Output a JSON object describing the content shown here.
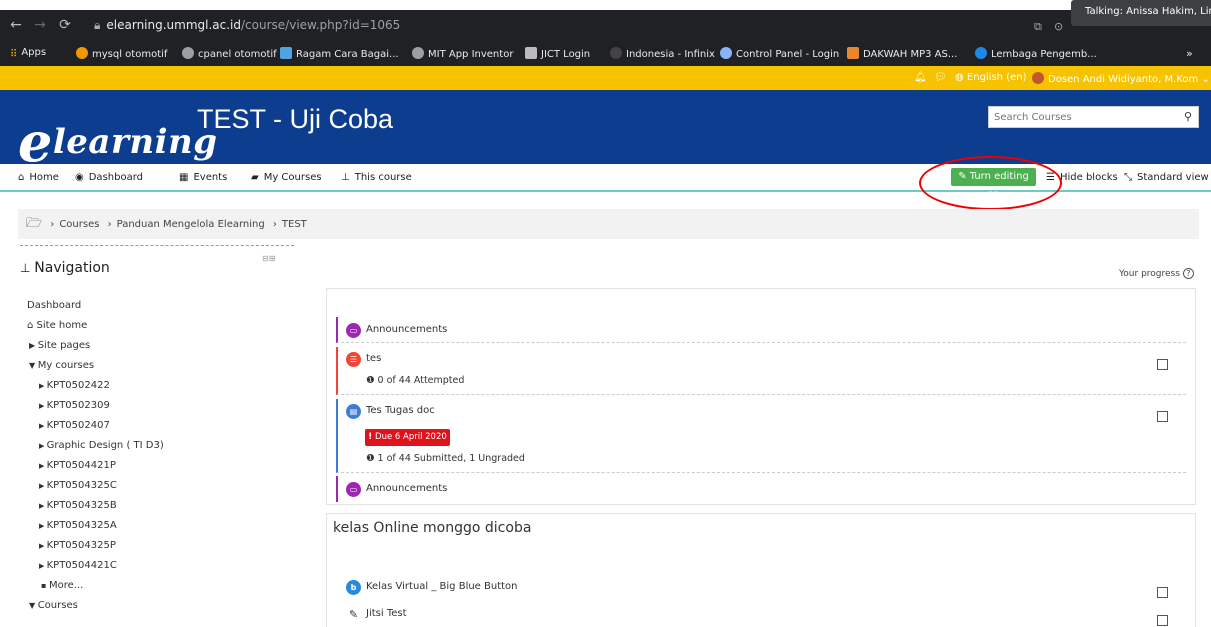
{
  "browser": {
    "url_domain": "elearning.ummgl.ac.id",
    "url_path": "/course/view.php?id=1065",
    "talking": "Talking: Anissa Hakim, Lin",
    "bookmarks": [
      {
        "label": "Apps",
        "color": "#f4b400"
      },
      {
        "label": "mysql otomotif",
        "color": "#f29900"
      },
      {
        "label": "cpanel otomotif",
        "color": "#9aa0a6"
      },
      {
        "label": "Ragam Cara Bagai...",
        "color": "#4fa3e3"
      },
      {
        "label": "MIT App Inventor",
        "color": "#9aa0a6"
      },
      {
        "label": "JICT Login",
        "color": "#bbbbbb"
      },
      {
        "label": "Indonesia - Infinix",
        "color": "#444444"
      },
      {
        "label": "Control Panel - Login",
        "color": "#8ab4f8"
      },
      {
        "label": "DAKWAH MP3 AS...",
        "color": "#e8872e"
      },
      {
        "label": "Lembaga Pengemb...",
        "color": "#1e88e5"
      }
    ],
    "bookmarks_more": "»"
  },
  "topbar": {
    "language": "English (en)",
    "user": "Dosen Andi Widiyanto, M.Kom"
  },
  "header": {
    "logo_text": "lea rning",
    "logo_letter": "e",
    "logo_word": "learning",
    "site_title": "TEST - Uji Coba",
    "search_placeholder": "Search Courses"
  },
  "menu": {
    "home": "Home",
    "dashboard": "Dashboard",
    "events": "Events",
    "my_courses": "My Courses",
    "this_course": "This course",
    "turn_editing_on": "Turn editing on",
    "hide_blocks": "Hide blocks",
    "standard_view": "Standard view"
  },
  "breadcrumb": {
    "courses": "Courses",
    "category": "Panduan Mengelola Elearning",
    "current": "TEST",
    "sep": "›"
  },
  "navigation": {
    "title": "Navigation",
    "dashboard": "Dashboard",
    "site_home": "Site home",
    "site_pages": "Site pages",
    "my_courses": "My courses",
    "courses": [
      "KPT0502422",
      "KPT0502309",
      "KPT0502407",
      "Graphic Design ( TI D3)",
      "KPT0504421P",
      "KPT0504325C",
      "KPT0504325B",
      "KPT0504325A",
      "KPT0504325P",
      "KPT0504421C"
    ],
    "more": "More...",
    "courses_label": "Courses"
  },
  "progress_label": "Your progress",
  "activities": {
    "announcements_1": "Announcements",
    "tes": "tes",
    "tes_status": "0 of 44 Attempted",
    "tugas": "Tes Tugas doc",
    "due": "Due 6 April 2020",
    "tugas_status": "1 of 44 Submitted, 1 Ungraded",
    "announcements_2": "Announcements"
  },
  "section2": {
    "title": "kelas Online monggo dicoba",
    "bbb": "Kelas Virtual _ Big Blue Button",
    "jitsi": "Jitsi Test"
  },
  "colors": {
    "brand_blue": "#0c3d8e",
    "yellow_bar": "#f7c300",
    "edit_green": "#4caf50",
    "due_red": "#e0121b",
    "annotation_red": "#e00000"
  }
}
